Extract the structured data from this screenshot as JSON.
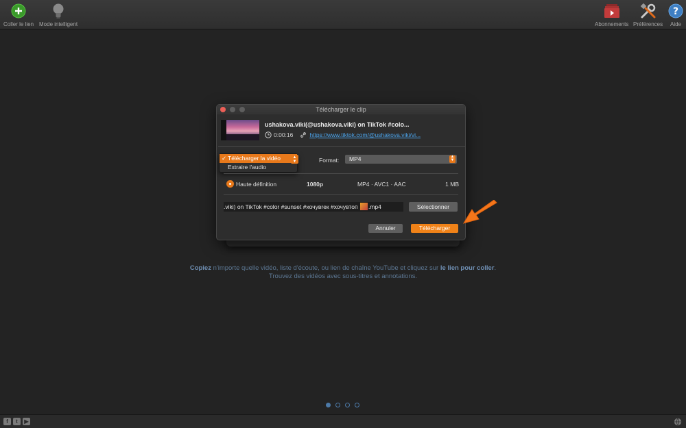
{
  "toolbar": {
    "paste_link": "Coller le lien",
    "smart_mode": "Mode intelligent",
    "subscriptions": "Abonnements",
    "preferences": "Préférences",
    "help": "Aide"
  },
  "dialog": {
    "title": "Télécharger le clip",
    "clip_title": "ushakova.viki(@ushakova.viki) on TikTok #colo...",
    "duration": "0:00:16",
    "url": "https://www.tiktok.com/@ushakova.viki/vi...",
    "mode_options": [
      "Télécharger la vidéo",
      "Extraire l'audio"
    ],
    "mode_selected_index": 0,
    "format_label": "Format:",
    "format_value": "MP4",
    "quality": {
      "name": "Haute définition",
      "resolution": "1080p",
      "codec": "MP4 · AVC1 · AAC",
      "size": "1 MB"
    },
    "filename": ".viki) on TikTok #color #sunset #хочувrек #хочувтоп",
    "filename_ext": ".mp4",
    "select_button": "Sélectionner",
    "cancel_button": "Annuler",
    "download_button": "Télécharger"
  },
  "hint": {
    "line1_strong1": "Copiez",
    "line1_text": " n'importe quelle vidéo, liste d'écoute, ou lien de chaîne YouTube et cliquez sur ",
    "line1_strong2": "le lien pour coller",
    "line1_end": ".",
    "line2": "Trouvez des vidéos avec sous-titres et annotations."
  },
  "pagination": {
    "pages": 4,
    "current": 1
  },
  "colors": {
    "accent": "#f08218",
    "link": "#4ba3ea",
    "hint": "#5d7894"
  },
  "icons": [
    "plus-circle-icon",
    "lightbulb-icon",
    "subscriptions-icon",
    "tools-icon",
    "help-icon",
    "clock-icon",
    "link-icon",
    "facebook-icon",
    "twitter-icon",
    "youtube-icon",
    "globe-icon"
  ]
}
